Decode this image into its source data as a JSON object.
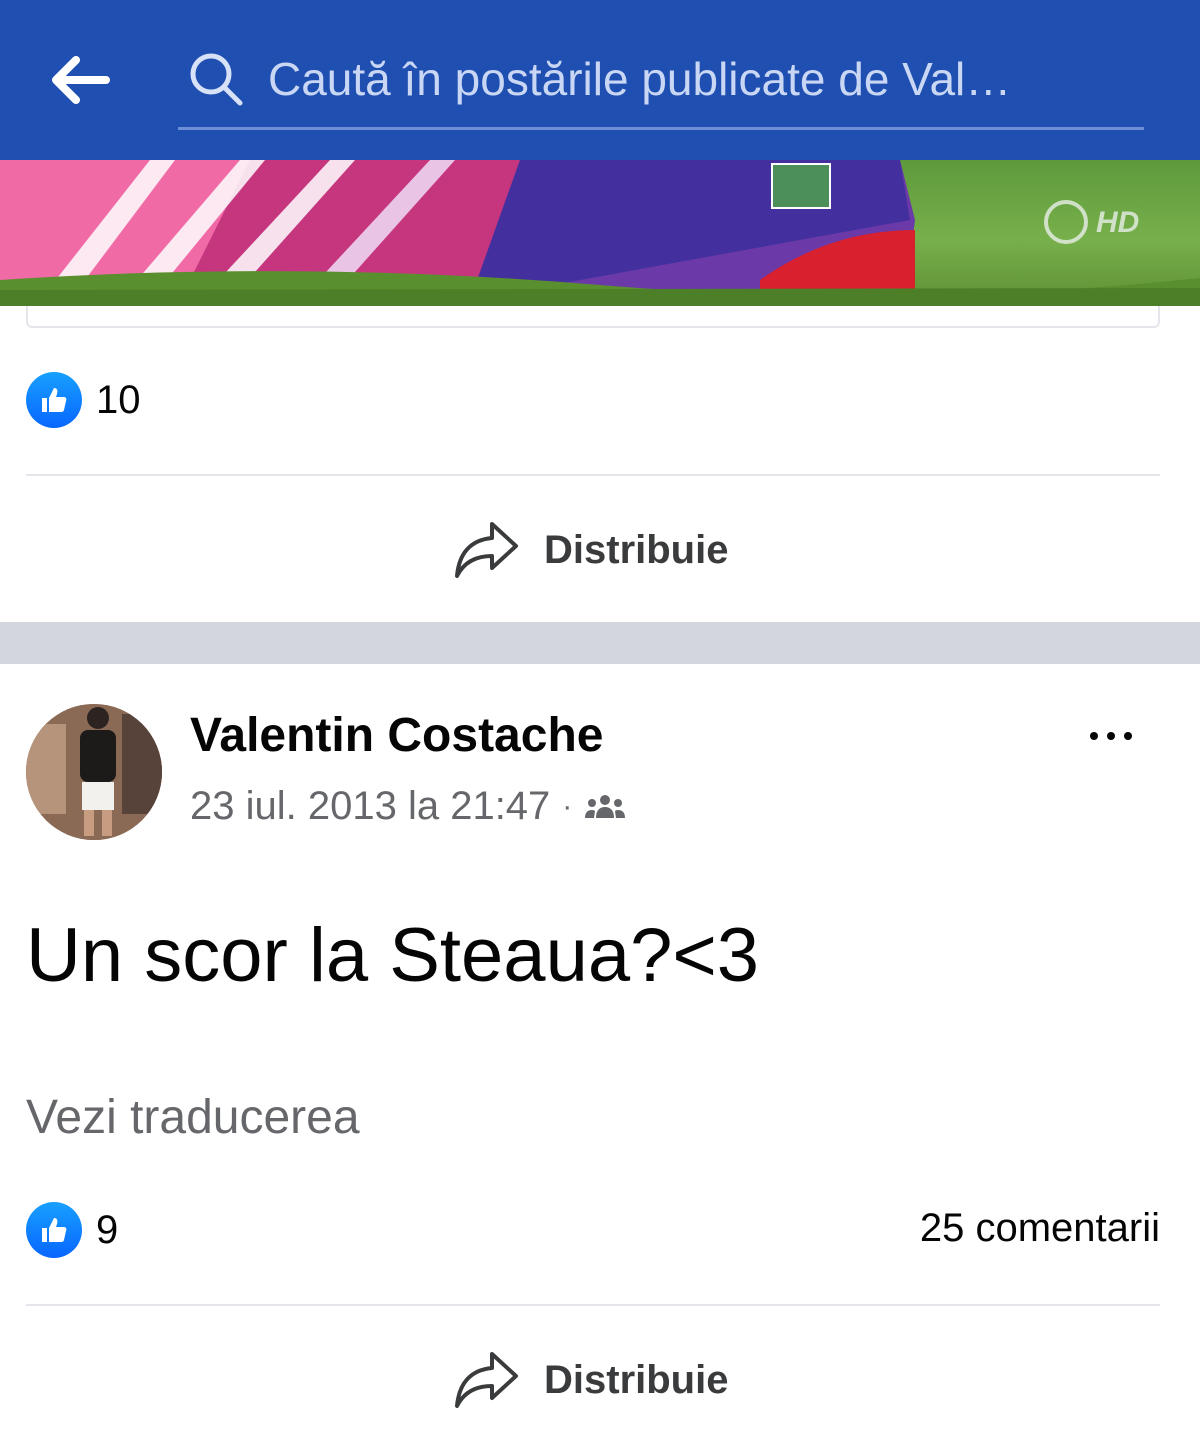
{
  "header": {
    "search_placeholder": "Caută în postările publicate de Val…",
    "back_icon": "arrow-left-icon",
    "search_icon": "search-icon",
    "bg_color": "#1f4fb0"
  },
  "post1": {
    "like_count": "10",
    "share_label": "Distribuie",
    "image_watermark": "HD"
  },
  "post2": {
    "author": "Valentin Costache",
    "timestamp": "23 iul. 2013 la 21:47",
    "meta_separator": "·",
    "audience_icon": "friends-icon",
    "text": "Un scor la Steaua?<3",
    "translate_label": "Vezi traducerea",
    "like_count": "9",
    "comments_label": "25 comentarii",
    "share_label": "Distribuie"
  },
  "colors": {
    "like_blue": "#0866ff",
    "separator": "#d3d6dc",
    "secondary_text": "#65676b"
  }
}
